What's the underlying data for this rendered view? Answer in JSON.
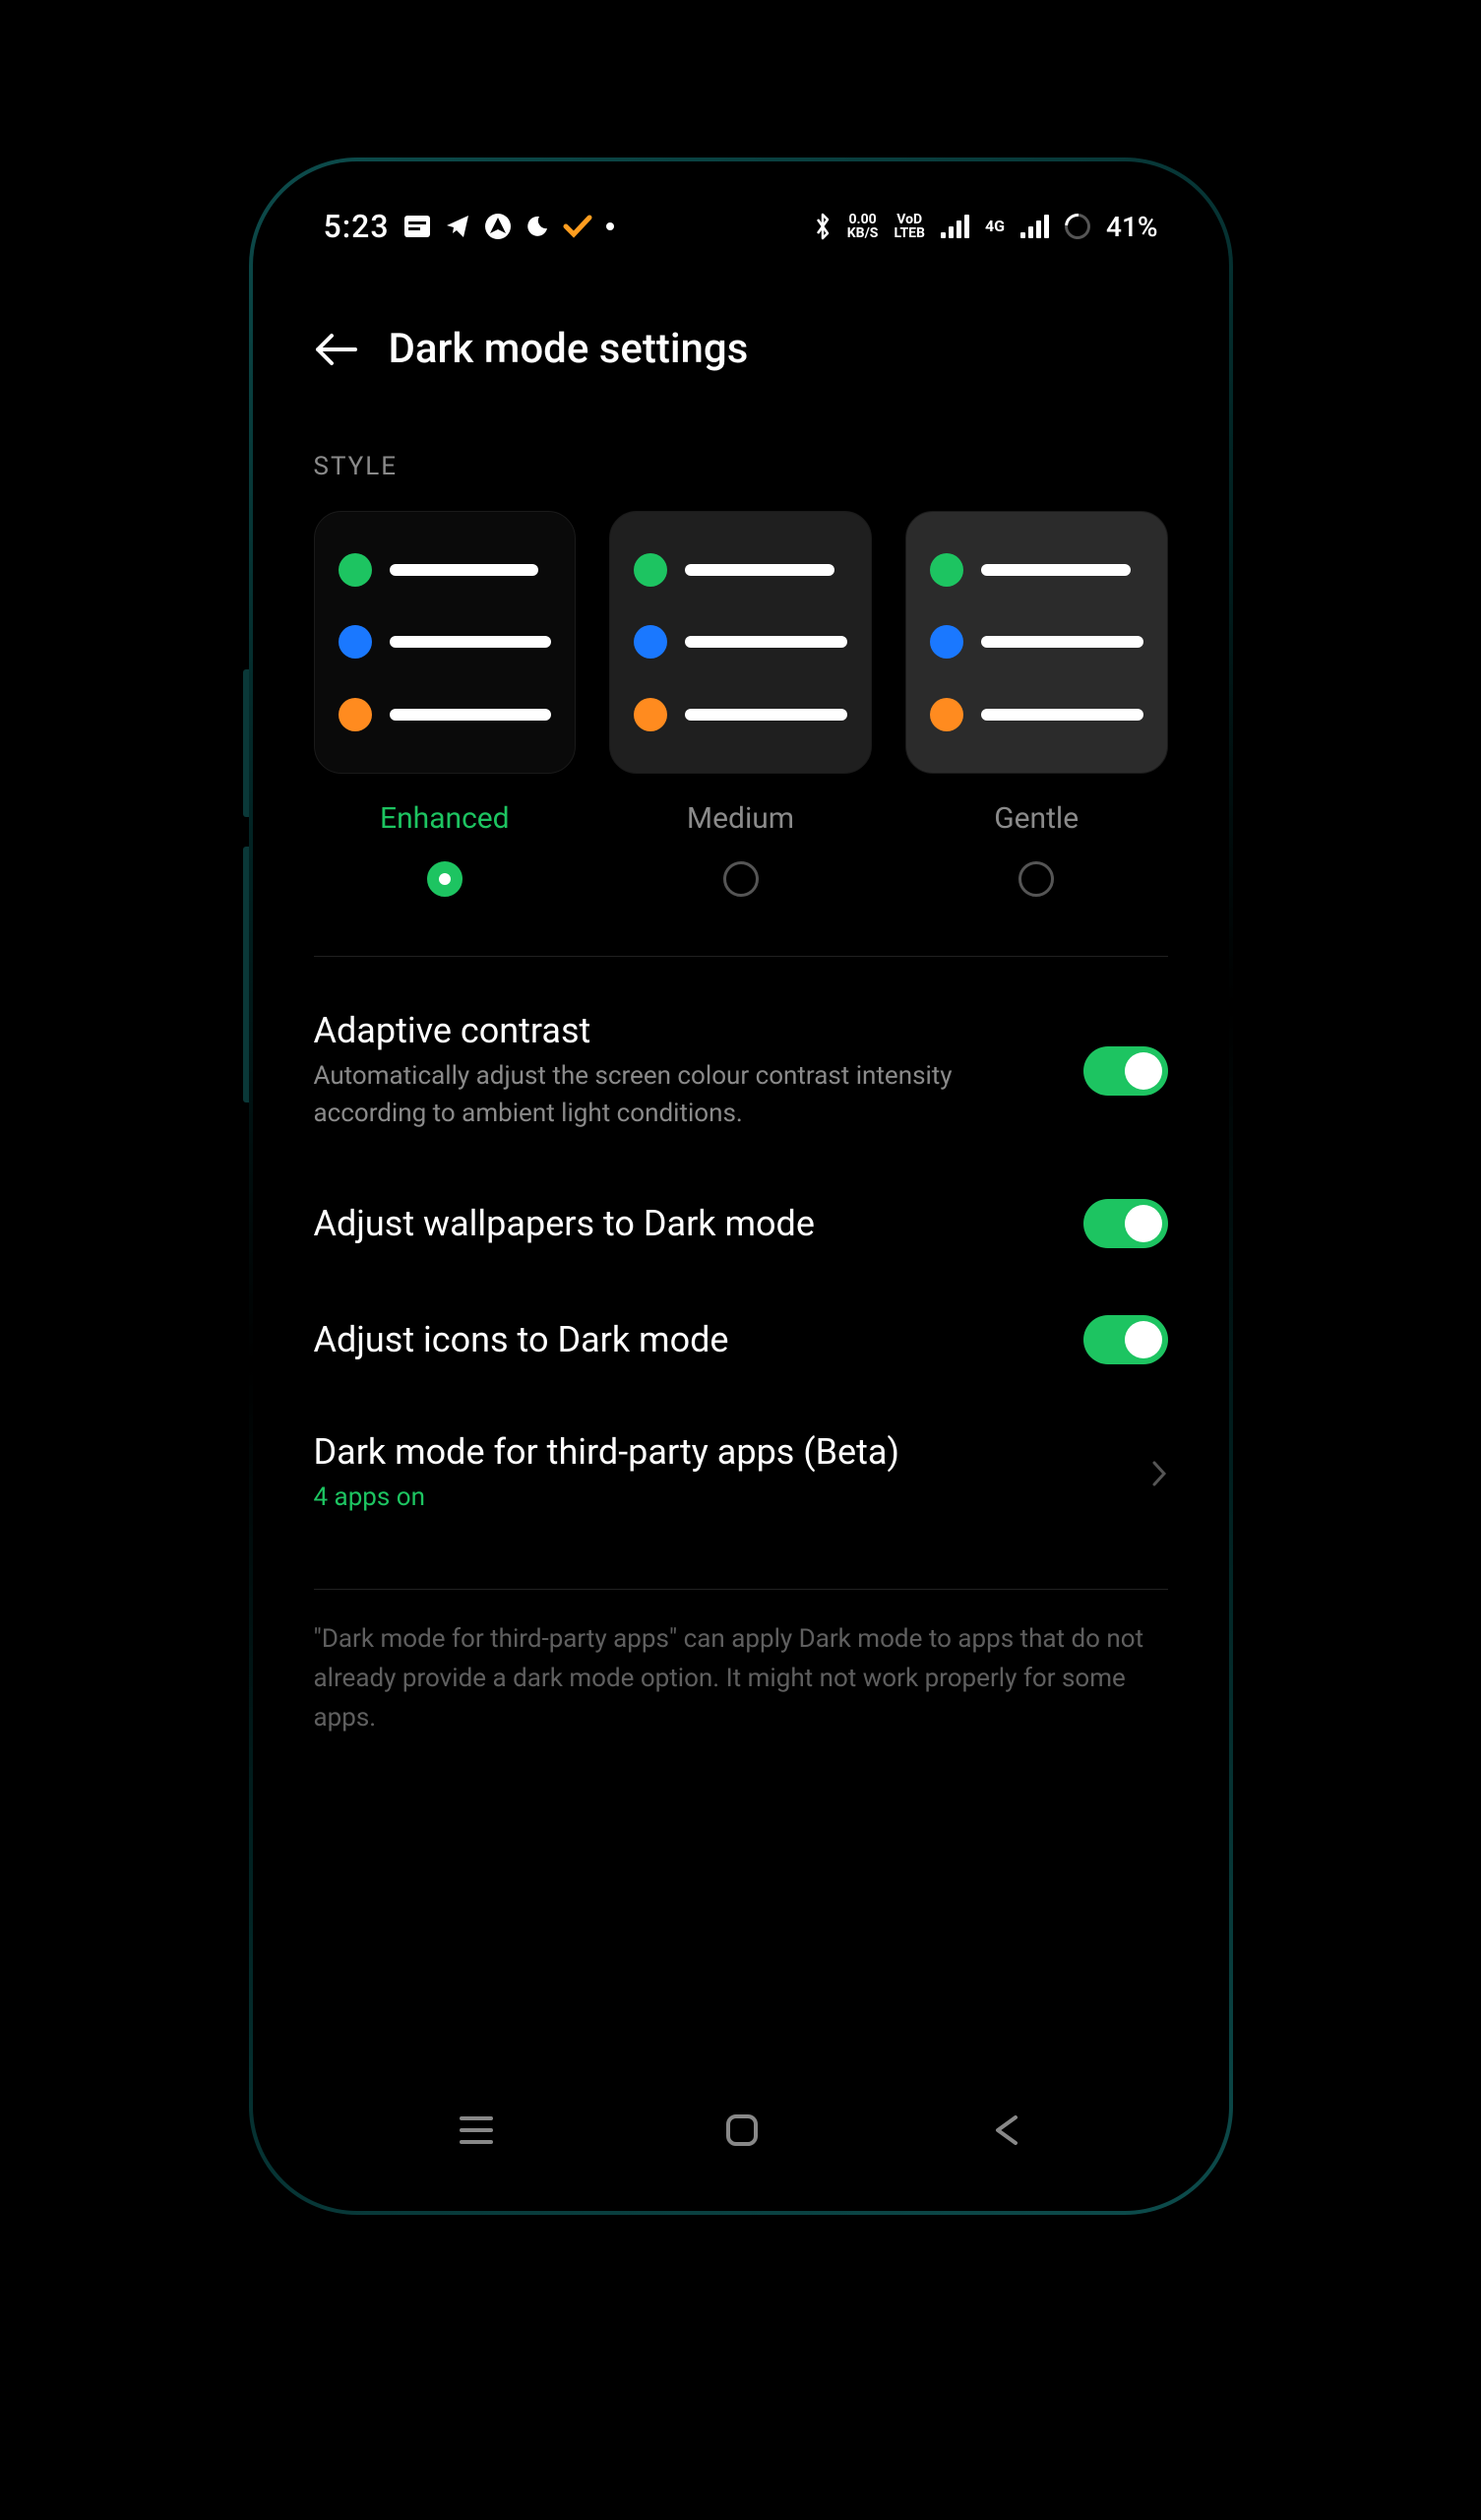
{
  "status": {
    "time": "5:23",
    "net_speed_top": "0.00",
    "net_speed_bottom": "KB/S",
    "volte_top": "VoD",
    "volte_bottom": "LTEB",
    "net_gen": "4G",
    "battery_text": "41%"
  },
  "header": {
    "title": "Dark mode settings"
  },
  "style_section": {
    "label": "STYLE",
    "options": [
      "Enhanced",
      "Medium",
      "Gentle"
    ],
    "selected_index": 0
  },
  "settings": {
    "adaptive_contrast": {
      "title": "Adaptive contrast",
      "subtitle": "Automatically adjust the screen colour contrast intensity according to ambient light conditions.",
      "on": true
    },
    "adjust_wallpapers": {
      "title": "Adjust wallpapers to Dark mode",
      "on": true
    },
    "adjust_icons": {
      "title": "Adjust icons to Dark mode",
      "on": true
    },
    "third_party": {
      "title": "Dark mode for third-party apps (Beta)",
      "subtitle": "4 apps on"
    }
  },
  "footnote": "\"Dark mode for third-party apps\" can apply Dark mode to apps that do not already provide a dark mode option. It might not work properly for some apps.",
  "colors": {
    "accent": "#1dc461"
  }
}
